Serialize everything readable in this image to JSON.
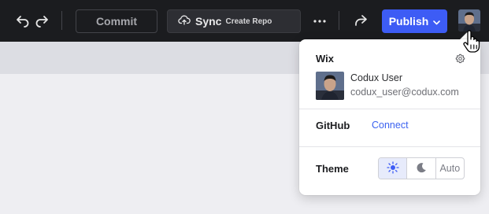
{
  "toolbar": {
    "undo_icon": "undo-icon",
    "redo_icon": "redo-icon",
    "commit_label": "Commit",
    "sync_label": "Sync",
    "sync_sublabel": "Create Repo",
    "sync_icon": "cloud-upload-icon",
    "more_icon": "more-horizontal-icon",
    "share_icon": "share-arrow-icon",
    "publish_label": "Publish",
    "publish_icon": "chevron-down-icon",
    "accent_color": "#3d5cf5"
  },
  "account_menu": {
    "wix_section_title": "Wix",
    "settings_icon": "gear-icon",
    "user_name": "Codux User",
    "user_email": "codux_user@codux.com",
    "github_section_title": "GitHub",
    "github_action": "Connect",
    "theme_section_title": "Theme",
    "theme_options": [
      {
        "name": "light",
        "icon": "sun-icon",
        "selected": true
      },
      {
        "name": "dark",
        "icon": "moon-icon",
        "selected": false
      },
      {
        "name": "auto",
        "label": "Auto",
        "selected": false
      }
    ]
  }
}
